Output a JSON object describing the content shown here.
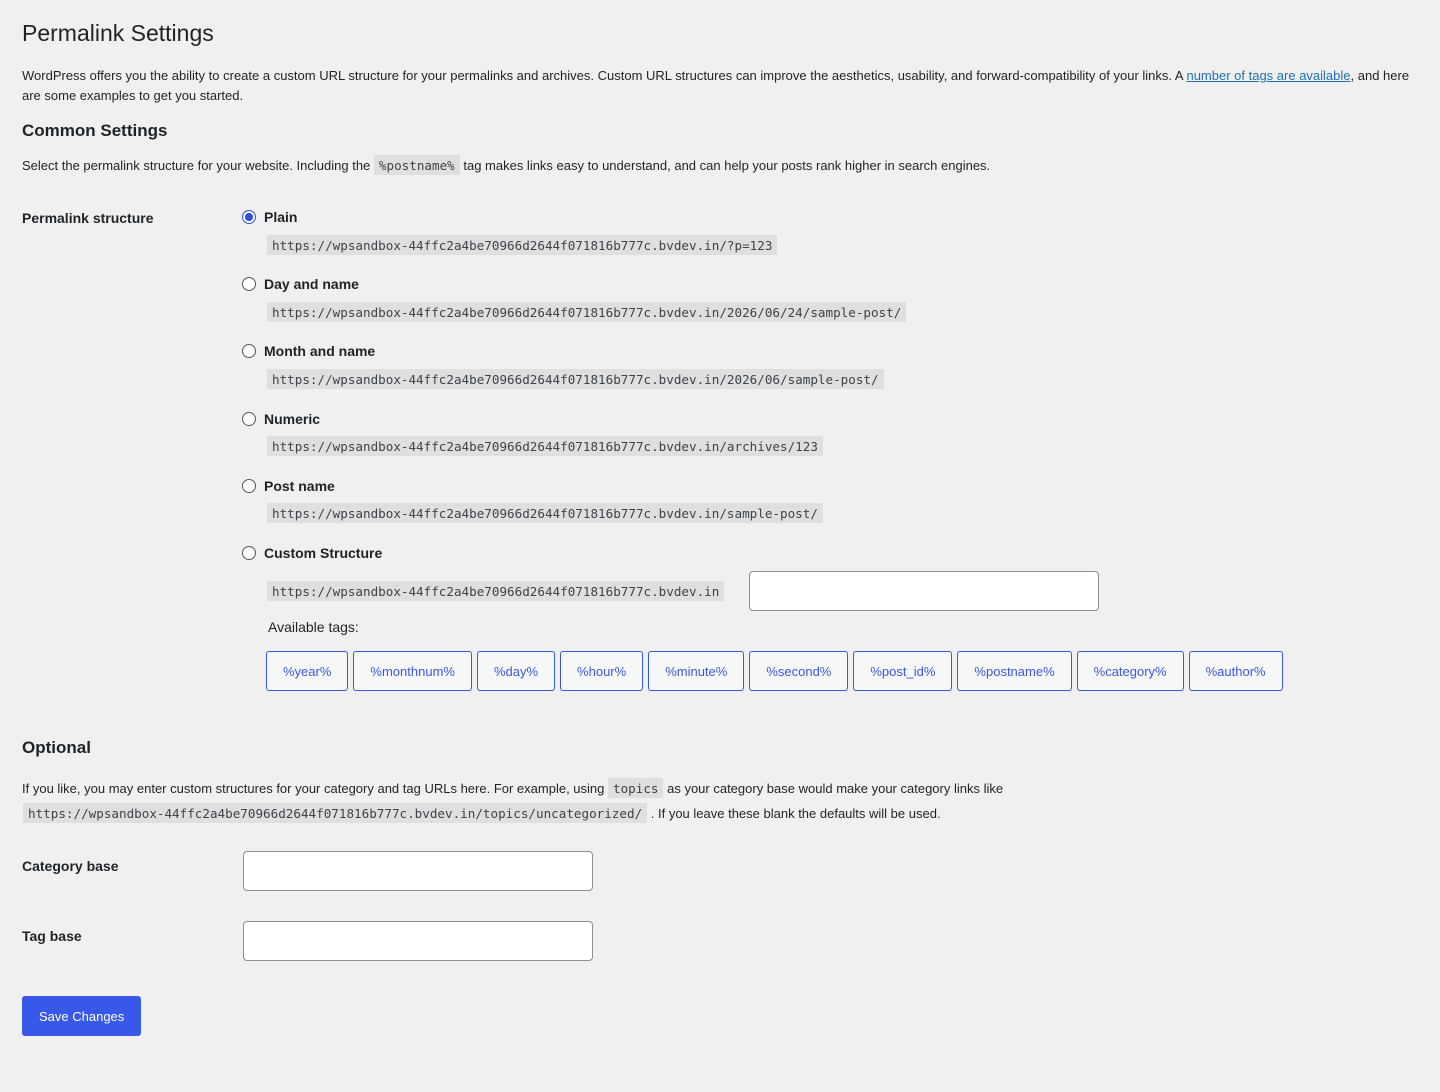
{
  "page": {
    "title": "Permalink Settings",
    "intro_before": "WordPress offers you the ability to create a custom URL structure for your permalinks and archives. Custom URL structures can improve the aesthetics, usability, and forward-compatibility of your links. A ",
    "intro_link": "number of tags are available",
    "intro_after": ", and here are some examples to get you started."
  },
  "common": {
    "heading": "Common Settings",
    "desc_before": "Select the permalink structure for your website. Including the ",
    "desc_code": "%postname%",
    "desc_after": " tag makes links easy to understand, and can help your posts rank higher in search engines.",
    "row_label": "Permalink structure",
    "options": [
      {
        "label": "Plain",
        "sample": "https://wpsandbox-44ffc2a4be70966d2644f071816b777c.bvdev.in/?p=123",
        "checked": true
      },
      {
        "label": "Day and name",
        "sample": "https://wpsandbox-44ffc2a4be70966d2644f071816b777c.bvdev.in/2026/06/24/sample-post/",
        "checked": false
      },
      {
        "label": "Month and name",
        "sample": "https://wpsandbox-44ffc2a4be70966d2644f071816b777c.bvdev.in/2026/06/sample-post/",
        "checked": false
      },
      {
        "label": "Numeric",
        "sample": "https://wpsandbox-44ffc2a4be70966d2644f071816b777c.bvdev.in/archives/123",
        "checked": false
      },
      {
        "label": "Post name",
        "sample": "https://wpsandbox-44ffc2a4be70966d2644f071816b777c.bvdev.in/sample-post/",
        "checked": false
      },
      {
        "label": "Custom Structure",
        "sample": "https://wpsandbox-44ffc2a4be70966d2644f071816b777c.bvdev.in",
        "checked": false
      }
    ],
    "custom_value": "",
    "available_tags_label": "Available tags:",
    "tags": [
      "%year%",
      "%monthnum%",
      "%day%",
      "%hour%",
      "%minute%",
      "%second%",
      "%post_id%",
      "%postname%",
      "%category%",
      "%author%"
    ]
  },
  "optional": {
    "heading": "Optional",
    "desc_before": "If you like, you may enter custom structures for your category and tag URLs here. For example, using ",
    "desc_code1": "topics",
    "desc_middle": " as your category base would make your category links like",
    "desc_code2": "https://wpsandbox-44ffc2a4be70966d2644f071816b777c.bvdev.in/topics/uncategorized/",
    "desc_after": " . If you leave these blank the defaults will be used.",
    "category_label": "Category base",
    "category_value": "",
    "tag_label": "Tag base",
    "tag_value": ""
  },
  "actions": {
    "save_label": "Save Changes"
  },
  "colors": {
    "accent": "#3858e9",
    "background": "#f0f0f1",
    "text": "#1d2327"
  }
}
